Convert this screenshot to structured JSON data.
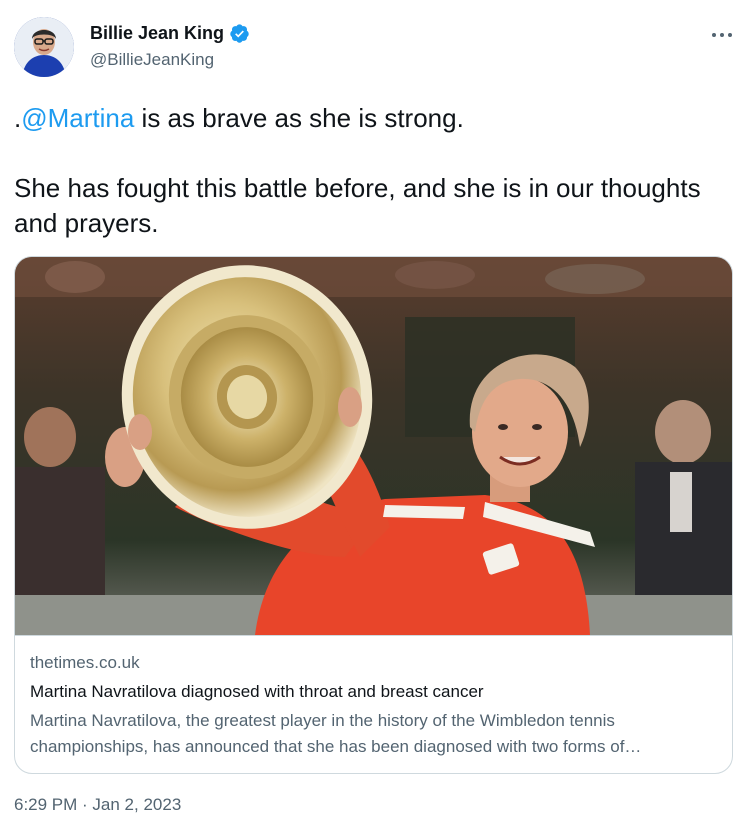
{
  "author": {
    "display_name": "Billie Jean King",
    "handle": "@BillieJeanKing",
    "verified": true
  },
  "tweet": {
    "mention": "@Martina",
    "line1_prefix": ".",
    "line1_rest": " is as brave as she is strong.",
    "paragraph2": "She has fought this battle before, and she is in our thoughts and prayers."
  },
  "card": {
    "domain": "thetimes.co.uk",
    "title": "Martina Navratilova diagnosed with throat and breast cancer",
    "description": "Martina Navratilova, the greatest player in the history of the Wimbledon tennis championships, has announced that she has been diagnosed with two forms of…"
  },
  "meta": {
    "timestamp": "6:29 PM · Jan 2, 2023"
  },
  "icons": {
    "verified": "verified-badge-icon",
    "more": "more-options-icon"
  },
  "colors": {
    "link": "#1d9bf0",
    "text": "#0f1419",
    "secondary_text": "#536471",
    "border": "#cfd9de"
  }
}
